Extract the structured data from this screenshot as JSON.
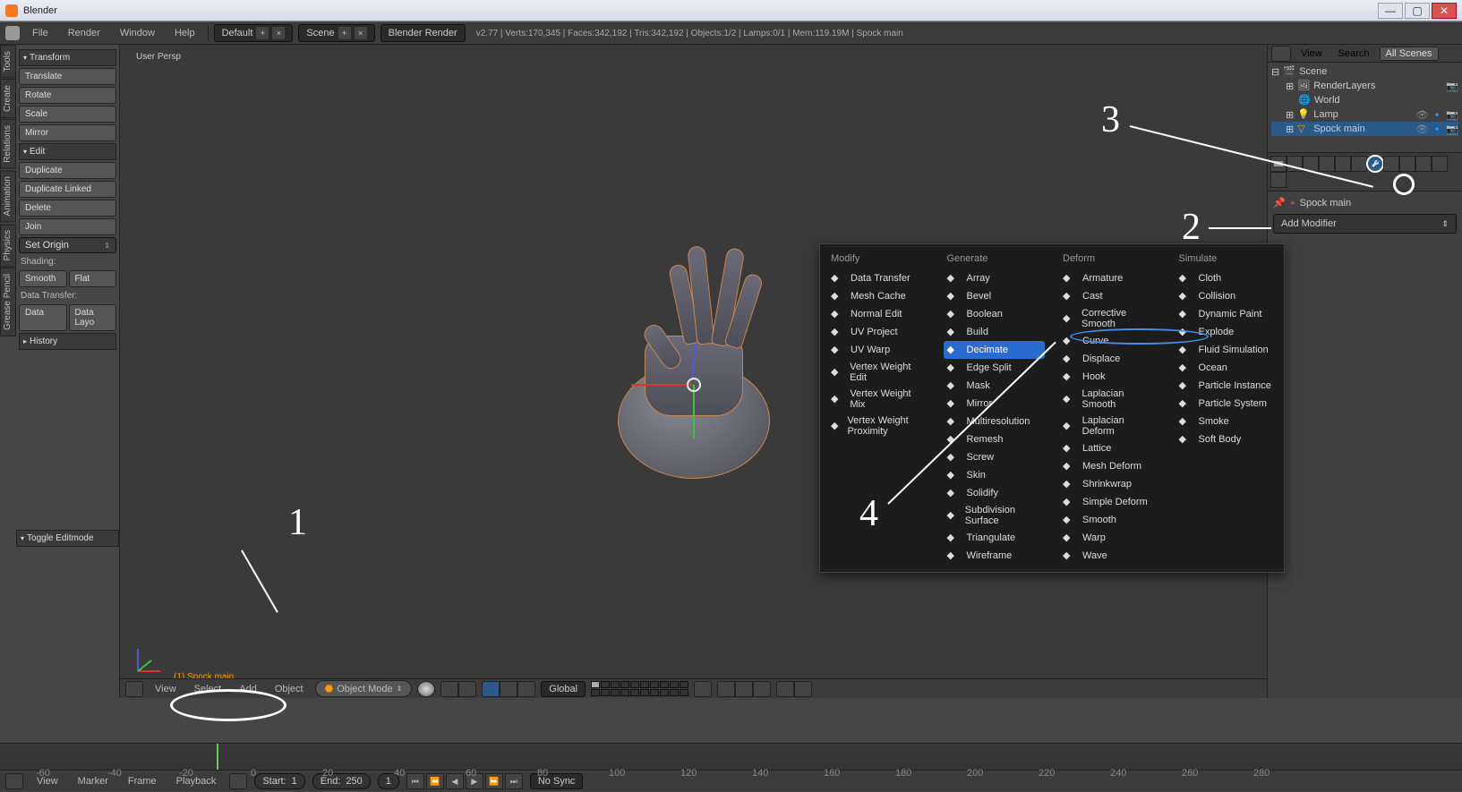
{
  "titlebar": {
    "title": "Blender"
  },
  "window_buttons": {
    "min": "—",
    "max": "▢",
    "close": "✕"
  },
  "menubar": {
    "items": [
      "File",
      "Render",
      "Window",
      "Help"
    ],
    "layout": "Default",
    "scene": "Scene",
    "engine": "Blender Render",
    "stats": "v2.77 | Verts:170,345 | Faces:342,192 | Tris:342,192 | Objects:1/2 | Lamps:0/1 | Mem:119.19M | Spock main"
  },
  "sidetabs": [
    "Tools",
    "Create",
    "Relations",
    "Animation",
    "Physics",
    "Grease Pencil"
  ],
  "toolshelf": {
    "transform_hdr": "Transform",
    "translate": "Translate",
    "rotate": "Rotate",
    "scale": "Scale",
    "mirror": "Mirror",
    "edit_hdr": "Edit",
    "dup": "Duplicate",
    "dup_linked": "Duplicate Linked",
    "delete": "Delete",
    "join": "Join",
    "set_origin": "Set Origin",
    "shading_lbl": "Shading:",
    "smooth": "Smooth",
    "flat": "Flat",
    "data_lbl": "Data Transfer:",
    "data": "Data",
    "data_layo": "Data Layo",
    "history_hdr": "History",
    "toggle_edit": "Toggle Editmode"
  },
  "viewport": {
    "label": "User Persp",
    "object_label": "(1) Spock main",
    "header": {
      "view": "View",
      "select": "Select",
      "add": "Add",
      "object": "Object",
      "mode": "Object Mode",
      "orient": "Global"
    }
  },
  "outliner": {
    "view": "View",
    "search": "Search",
    "all_scenes": "All Scenes",
    "scene": "Scene",
    "render_layers": "RenderLayers",
    "world": "World",
    "lamp": "Lamp",
    "spock": "Spock main"
  },
  "props": {
    "obj": "Spock main",
    "add_modifier": "Add Modifier"
  },
  "modifiers": {
    "cols": {
      "modify": {
        "hdr": "Modify",
        "items": [
          "Data Transfer",
          "Mesh Cache",
          "Normal Edit",
          "UV Project",
          "UV Warp",
          "Vertex Weight Edit",
          "Vertex Weight Mix",
          "Vertex Weight Proximity"
        ]
      },
      "generate": {
        "hdr": "Generate",
        "items": [
          "Array",
          "Bevel",
          "Boolean",
          "Build",
          "Decimate",
          "Edge Split",
          "Mask",
          "Mirror",
          "Multiresolution",
          "Remesh",
          "Screw",
          "Skin",
          "Solidify",
          "Subdivision Surface",
          "Triangulate",
          "Wireframe"
        ]
      },
      "deform": {
        "hdr": "Deform",
        "items": [
          "Armature",
          "Cast",
          "Corrective Smooth",
          "Curve",
          "Displace",
          "Hook",
          "Laplacian Smooth",
          "Laplacian Deform",
          "Lattice",
          "Mesh Deform",
          "Shrinkwrap",
          "Simple Deform",
          "Smooth",
          "Warp",
          "Wave"
        ]
      },
      "simulate": {
        "hdr": "Simulate",
        "items": [
          "Cloth",
          "Collision",
          "Dynamic Paint",
          "Explode",
          "Fluid Simulation",
          "Ocean",
          "Particle Instance",
          "Particle System",
          "Smoke",
          "Soft Body"
        ]
      }
    },
    "highlight": "Decimate"
  },
  "timeline": {
    "view": "View",
    "marker": "Marker",
    "frame": "Frame",
    "playback": "Playback",
    "start_lbl": "Start:",
    "start_val": "1",
    "end_lbl": "End:",
    "end_val": "250",
    "frame_val": "1",
    "nosync": "No Sync",
    "ticks": [
      "-60",
      "-40",
      "-20",
      "0",
      "20",
      "40",
      "60",
      "80",
      "100",
      "120",
      "140",
      "160",
      "180",
      "200",
      "220",
      "240",
      "260",
      "280"
    ]
  },
  "annotations": {
    "a1": "1",
    "a2": "2",
    "a3": "3",
    "a4": "4"
  }
}
